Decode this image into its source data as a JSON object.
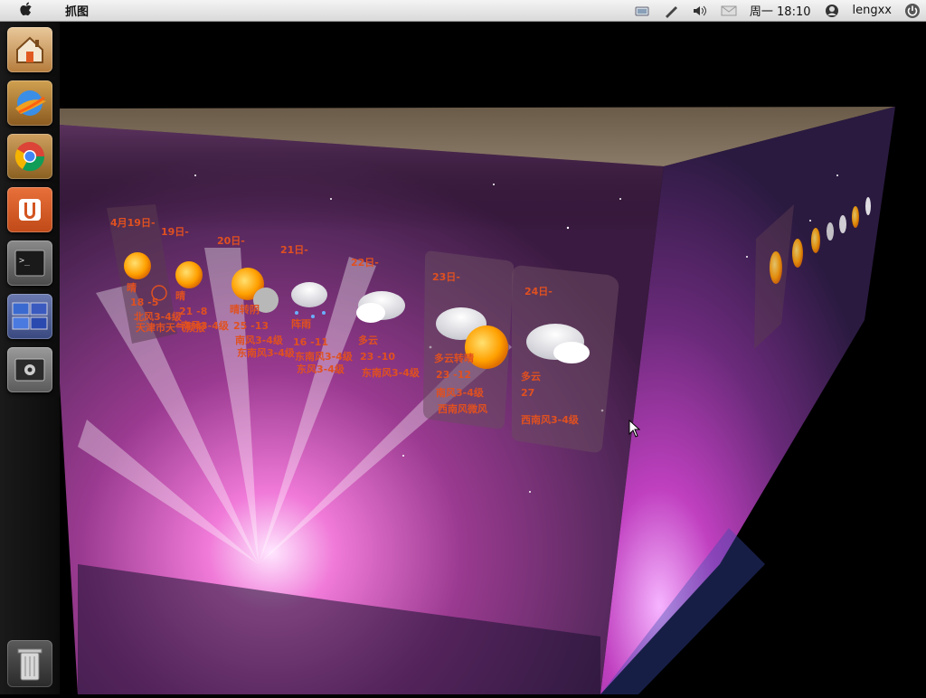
{
  "menubar": {
    "app_title": "抓图",
    "clock": "周一 18:10",
    "user": "lengxx"
  },
  "icons": {
    "apple": "apple-icon",
    "network": "network-icon",
    "pen": "pen-icon",
    "volume": "volume-icon",
    "mail": "mail-icon",
    "user": "user-icon",
    "power": "power-icon"
  },
  "launcher": {
    "items": [
      {
        "name": "home-folder-icon"
      },
      {
        "name": "browser-icon"
      },
      {
        "name": "chrome-icon"
      },
      {
        "name": "ubuntu-one-icon"
      },
      {
        "name": "terminal-icon"
      },
      {
        "name": "workspace-switcher-icon"
      },
      {
        "name": "system-settings-icon"
      }
    ],
    "trash": "trash-icon"
  },
  "forecast": [
    {
      "date": "4月19日-",
      "cond": "晴",
      "temp": "18 -5",
      "wind": "北风3-4级",
      "extra": "天津市天气预报"
    },
    {
      "date": "19日-",
      "cond": "晴",
      "temp": "21 -8",
      "wind": "南风3-4级",
      "extra": ""
    },
    {
      "date": "20日-",
      "cond": "晴转阴",
      "temp": "25 -13",
      "wind": "南风3-4级",
      "extra": "东南风3-4级"
    },
    {
      "date": "21日-",
      "cond": "阵雨",
      "temp": "16 -11",
      "wind": "东南风3-4级",
      "extra": "东风3-4级"
    },
    {
      "date": "22日-",
      "cond": "多云",
      "temp": "23 -10",
      "wind": "东南风3-4级",
      "extra": ""
    },
    {
      "date": "23日-",
      "cond": "多云转晴",
      "temp": "23 -12",
      "wind": "南风3-4级",
      "extra": "西南风微风"
    },
    {
      "date": "24日-",
      "cond": "多云",
      "temp": "27",
      "wind": "西南风3-4级",
      "extra": ""
    }
  ],
  "colors": {
    "forecast_text": "#e05020",
    "sun": "#ffb000"
  }
}
